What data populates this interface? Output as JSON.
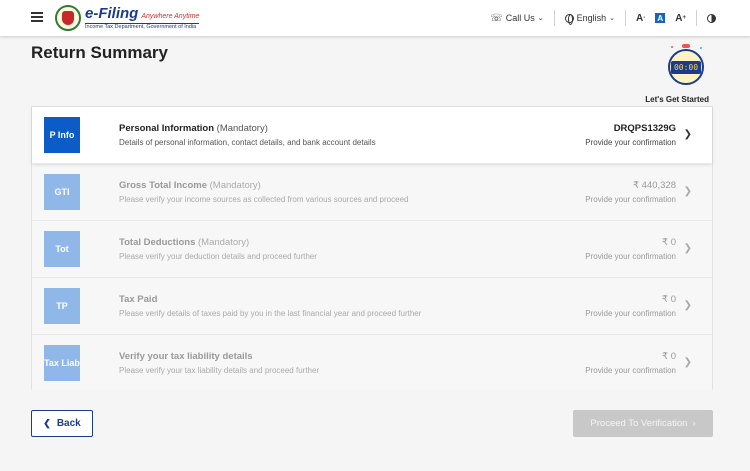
{
  "header": {
    "logo_title": "e-Filing",
    "logo_tagline": "Anywhere Anytime",
    "logo_subtitle": "Income Tax Department, Government of India",
    "call_us": "Call Us",
    "language": "English",
    "font_increase": "A+",
    "font_normal": "A",
    "font_decrease": "A-"
  },
  "page": {
    "title": "Return Summary",
    "timer": "00:00",
    "timer_caption": "Let's Get Started"
  },
  "sections": [
    {
      "badge": "P Info",
      "title": "Personal Information",
      "mandatory": "(Mandatory)",
      "description": "Details of personal information, contact details, and bank account details",
      "value": "DRQPS1329G",
      "status": "Provide your confirmation",
      "state": "active"
    },
    {
      "badge": "GTI",
      "title": "Gross Total Income",
      "mandatory": "(Mandatory)",
      "description": "Please verify your income sources as collected from various sources and proceed",
      "value": "₹ 440,328",
      "status": "Provide your confirmation",
      "state": "disabled"
    },
    {
      "badge": "Tot",
      "title": "Total Deductions",
      "mandatory": "(Mandatory)",
      "description": "Please verify your deduction details and proceed further",
      "value": "₹ 0",
      "status": "Provide your confirmation",
      "state": "disabled"
    },
    {
      "badge": "TP",
      "title": "Tax Paid",
      "mandatory": "",
      "description": "Please verify details of taxes paid by you in the last financial year and proceed further",
      "value": "₹ 0",
      "status": "Provide your confirmation",
      "state": "disabled"
    },
    {
      "badge": "Tax Liab",
      "title": "Verify your tax liability details",
      "mandatory": "",
      "description": "Please verify your tax liability details and proceed further",
      "value": "₹ 0",
      "status": "Provide your confirmation",
      "state": "disabled"
    }
  ],
  "footer": {
    "back_label": "Back",
    "proceed_label": "Proceed To Verification"
  },
  "colors": {
    "brand_blue": "#0b5cc7",
    "badge_disabled": "#8fb8e8",
    "navy": "#1a3c8b"
  },
  "icons": {
    "menu": "hamburger-menu-icon",
    "phone": "phone-icon",
    "globe": "globe-icon",
    "contrast": "contrast-icon",
    "chevron": "chevron-right-icon"
  }
}
